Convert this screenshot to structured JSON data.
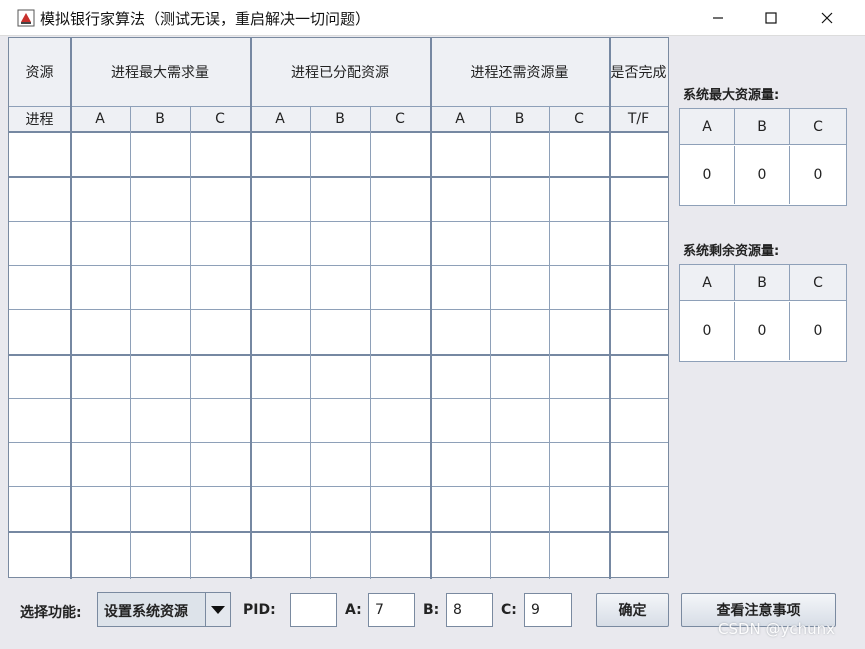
{
  "window": {
    "title": "模拟银行家算法（测试无误，重启解决一切问题）",
    "app_icon": "java-cup-icon",
    "controls": [
      "minimize-icon",
      "maximize-icon",
      "close-icon"
    ]
  },
  "table": {
    "group_headers": [
      "资源",
      "进程最大需求量",
      "进程已分配资源",
      "进程还需资源量",
      "是否完成"
    ],
    "sub_headers": [
      "进程",
      "A",
      "B",
      "C",
      "A",
      "B",
      "C",
      "A",
      "B",
      "C",
      "T/F"
    ],
    "row_count": 10
  },
  "system_max": {
    "label": "系统最大资源量:",
    "headers": [
      "A",
      "B",
      "C"
    ],
    "values": [
      "0",
      "0",
      "0"
    ]
  },
  "system_remaining": {
    "label": "系统剩余资源量:",
    "headers": [
      "A",
      "B",
      "C"
    ],
    "values": [
      "0",
      "0",
      "0"
    ]
  },
  "controls": {
    "function_label": "选择功能:",
    "function_selected": "设置系统资源",
    "pid_label": "PID:",
    "pid_value": "",
    "a_label": "A:",
    "a_value": "7",
    "b_label": "B:",
    "b_value": "8",
    "c_label": "C:",
    "c_value": "9",
    "confirm_label": "确定",
    "notes_label": "查看注意事项"
  },
  "watermark": "CSDN @ychunx"
}
